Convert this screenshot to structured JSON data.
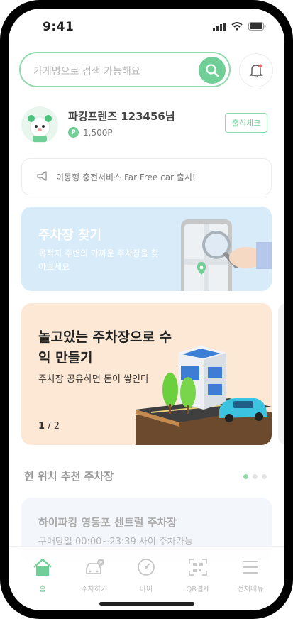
{
  "status_bar": {
    "time": "9:41"
  },
  "search": {
    "placeholder": "가게명으로 검색 가능해요"
  },
  "user": {
    "name": "파킹프렌즈 123456님",
    "points": "1,500P",
    "point_badge": "P",
    "checkin_label": "출석체크"
  },
  "notice": {
    "text": "이동형 충전서비스 Far Free car 출시!"
  },
  "find_card": {
    "title": "주차장 찾기",
    "desc": "목적지 주변의 가까운 주차장을 찾아보세요"
  },
  "share_card": {
    "title": "놀고있는 주차장으로 수익 만들기",
    "desc": "주차장 공유하면 돈이 쌓인다",
    "page_current": "1",
    "page_total": "/ 2"
  },
  "recommend": {
    "title": "현 위치 추천 주차장",
    "first_name": "하이파킹 영등포 센트럴 주차장",
    "first_hours": "구매당일 00:00~23:39 사이 주차가능"
  },
  "tabs": [
    {
      "label": "홈",
      "icon": "home-icon"
    },
    {
      "label": "주차하기",
      "icon": "car-icon"
    },
    {
      "label": "마이",
      "icon": "gauge-icon"
    },
    {
      "label": "QR결제",
      "icon": "qr-icon"
    },
    {
      "label": "전체메뉴",
      "icon": "menu-icon"
    }
  ],
  "colors": {
    "accent": "#6fcf97",
    "find_card_bg": "#d8ebf8",
    "share_card_bg": "#fce8d4"
  }
}
